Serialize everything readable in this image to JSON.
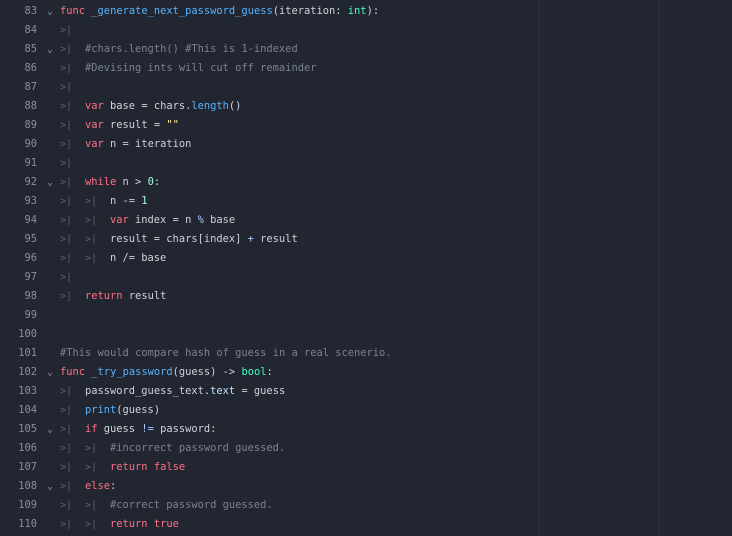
{
  "editor": {
    "lines": [
      {
        "number": "83",
        "fold": true,
        "indent": 0,
        "tokens": [
          {
            "t": "keyword",
            "v": "func"
          },
          {
            "t": "text",
            "v": " "
          },
          {
            "t": "func",
            "v": "_generate_next_password_guess"
          },
          {
            "t": "text",
            "v": "(iteration: "
          },
          {
            "t": "type",
            "v": "int"
          },
          {
            "t": "text",
            "v": "):"
          }
        ]
      },
      {
        "number": "84",
        "fold": false,
        "indent": 1,
        "tokens": []
      },
      {
        "number": "85",
        "fold": true,
        "indent": 1,
        "tokens": [
          {
            "t": "comment",
            "v": "#chars.length() #This is 1-indexed"
          }
        ]
      },
      {
        "number": "86",
        "fold": false,
        "indent": 1,
        "tokens": [
          {
            "t": "comment",
            "v": "#Devising ints will cut off remainder"
          }
        ]
      },
      {
        "number": "87",
        "fold": false,
        "indent": 1,
        "tokens": []
      },
      {
        "number": "88",
        "fold": false,
        "indent": 1,
        "tokens": [
          {
            "t": "keyword",
            "v": "var"
          },
          {
            "t": "text",
            "v": " base = chars."
          },
          {
            "t": "func",
            "v": "length"
          },
          {
            "t": "text",
            "v": "()"
          }
        ]
      },
      {
        "number": "89",
        "fold": false,
        "indent": 1,
        "tokens": [
          {
            "t": "keyword",
            "v": "var"
          },
          {
            "t": "text",
            "v": " result = "
          },
          {
            "t": "string",
            "v": "\"\""
          }
        ]
      },
      {
        "number": "90",
        "fold": false,
        "indent": 1,
        "tokens": [
          {
            "t": "keyword",
            "v": "var"
          },
          {
            "t": "text",
            "v": " n = iteration"
          }
        ]
      },
      {
        "number": "91",
        "fold": false,
        "indent": 1,
        "tokens": []
      },
      {
        "number": "92",
        "fold": true,
        "indent": 1,
        "tokens": [
          {
            "t": "keyword",
            "v": "while"
          },
          {
            "t": "text",
            "v": " n > "
          },
          {
            "t": "number",
            "v": "0"
          },
          {
            "t": "text",
            "v": ":"
          }
        ]
      },
      {
        "number": "93",
        "fold": false,
        "indent": 2,
        "tokens": [
          {
            "t": "text",
            "v": "n -= "
          },
          {
            "t": "number",
            "v": "1"
          }
        ]
      },
      {
        "number": "94",
        "fold": false,
        "indent": 2,
        "tokens": [
          {
            "t": "keyword",
            "v": "var"
          },
          {
            "t": "text",
            "v": " index = n "
          },
          {
            "t": "op",
            "v": "%"
          },
          {
            "t": "text",
            "v": " base"
          }
        ]
      },
      {
        "number": "95",
        "fold": false,
        "indent": 2,
        "tokens": [
          {
            "t": "text",
            "v": "result = chars[index] "
          },
          {
            "t": "op",
            "v": "+"
          },
          {
            "t": "text",
            "v": " result"
          }
        ]
      },
      {
        "number": "96",
        "fold": false,
        "indent": 2,
        "tokens": [
          {
            "t": "text",
            "v": "n /= base"
          }
        ]
      },
      {
        "number": "97",
        "fold": false,
        "indent": 1,
        "tokens": []
      },
      {
        "number": "98",
        "fold": false,
        "indent": 1,
        "tokens": [
          {
            "t": "keyword",
            "v": "return"
          },
          {
            "t": "text",
            "v": " result"
          }
        ]
      },
      {
        "number": "99",
        "fold": false,
        "indent": 0,
        "tokens": []
      },
      {
        "number": "100",
        "fold": false,
        "indent": 0,
        "tokens": []
      },
      {
        "number": "101",
        "fold": false,
        "indent": 0,
        "tokens": [
          {
            "t": "comment",
            "v": "#This would compare hash of guess in a real scenerio."
          }
        ]
      },
      {
        "number": "102",
        "fold": true,
        "indent": 0,
        "tokens": [
          {
            "t": "keyword",
            "v": "func"
          },
          {
            "t": "text",
            "v": " "
          },
          {
            "t": "func",
            "v": "_try_password"
          },
          {
            "t": "text",
            "v": "(guess) -> "
          },
          {
            "t": "type",
            "v": "bool"
          },
          {
            "t": "text",
            "v": ":"
          }
        ]
      },
      {
        "number": "103",
        "fold": false,
        "indent": 1,
        "tokens": [
          {
            "t": "text",
            "v": "password_guess_text."
          },
          {
            "t": "member",
            "v": "text"
          },
          {
            "t": "text",
            "v": " = guess"
          }
        ]
      },
      {
        "number": "104",
        "fold": false,
        "indent": 1,
        "tokens": [
          {
            "t": "func",
            "v": "print"
          },
          {
            "t": "text",
            "v": "(guess)"
          }
        ]
      },
      {
        "number": "105",
        "fold": true,
        "indent": 1,
        "tokens": [
          {
            "t": "keyword",
            "v": "if"
          },
          {
            "t": "text",
            "v": " guess "
          },
          {
            "t": "op",
            "v": "!="
          },
          {
            "t": "text",
            "v": " password:"
          }
        ]
      },
      {
        "number": "106",
        "fold": false,
        "indent": 2,
        "tokens": [
          {
            "t": "comment",
            "v": "#incorrect password guessed."
          }
        ]
      },
      {
        "number": "107",
        "fold": false,
        "indent": 2,
        "tokens": [
          {
            "t": "keyword",
            "v": "return"
          },
          {
            "t": "text",
            "v": " "
          },
          {
            "t": "keyword",
            "v": "false"
          }
        ]
      },
      {
        "number": "108",
        "fold": true,
        "indent": 1,
        "tokens": [
          {
            "t": "keyword",
            "v": "else"
          },
          {
            "t": "text",
            "v": ":"
          }
        ]
      },
      {
        "number": "109",
        "fold": false,
        "indent": 2,
        "tokens": [
          {
            "t": "comment",
            "v": "#correct password guessed."
          }
        ]
      },
      {
        "number": "110",
        "fold": false,
        "indent": 2,
        "tokens": [
          {
            "t": "keyword",
            "v": "return"
          },
          {
            "t": "text",
            "v": " "
          },
          {
            "t": "keyword",
            "v": "true"
          }
        ]
      }
    ],
    "icons": {
      "fold": "chevron-down-icon",
      "tab": "tab-indent-icon"
    },
    "colors": {
      "background": "#212631",
      "keyword": "#ff7085",
      "function": "#57b3ff",
      "type": "#42ffc2",
      "number": "#a1ffe0",
      "string": "#ffeda1",
      "comment": "#7b8290",
      "text": "#cdd2db"
    }
  }
}
